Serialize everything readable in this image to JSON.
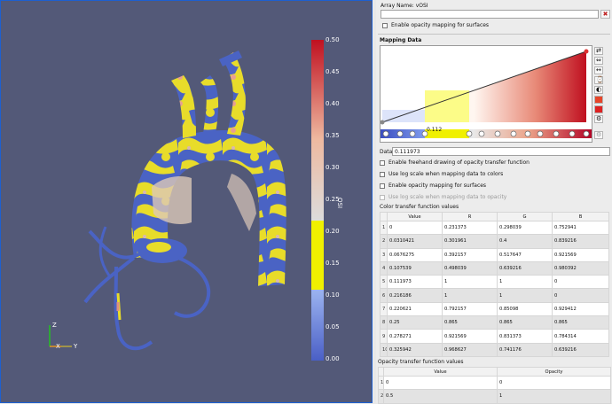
{
  "viewport": {
    "axes": {
      "z": "Z",
      "x": "X",
      "y": "Y"
    },
    "scalar_bar": {
      "title": "OSI",
      "labels": [
        "0.50",
        "0.45",
        "0.40",
        "0.35",
        "0.30",
        "0.25",
        "0.20",
        "0.15",
        "0.10",
        "0.05",
        "0.00"
      ]
    }
  },
  "panel": {
    "array_name": "Array Name: vOSI",
    "enable_opacity_surfaces": "Enable opacity mapping for surfaces",
    "mapping_data_title": "Mapping Data",
    "highlight_value": "0.112",
    "data_label": "Data:",
    "data_value": "0.111973",
    "options": [
      {
        "label": "Enable freehand drawing of opacity transfer function",
        "disabled": false
      },
      {
        "label": "Use log scale when mapping data to colors",
        "disabled": false
      },
      {
        "label": "Enable opacity mapping for surfaces",
        "disabled": false
      },
      {
        "label": "Use log scale when mapping data to opacity",
        "disabled": true
      }
    ],
    "color_table_title": "Color transfer function values",
    "color_table_headers": [
      "Value",
      "R",
      "G",
      "B"
    ],
    "color_table_rows": [
      [
        "1",
        "0",
        "0.231373",
        "0.298039",
        "0.752941"
      ],
      [
        "2",
        "0.0310421",
        "0.301961",
        "0.4",
        "0.839216"
      ],
      [
        "3",
        "0.0676275",
        "0.392157",
        "0.517647",
        "0.921569"
      ],
      [
        "4",
        "0.107539",
        "0.498039",
        "0.639216",
        "0.980392"
      ],
      [
        "5",
        "0.111973",
        "1",
        "1",
        "0"
      ],
      [
        "6",
        "0.216186",
        "1",
        "1",
        "0"
      ],
      [
        "7",
        "0.220621",
        "0.792157",
        "0.85098",
        "0.929412"
      ],
      [
        "8",
        "0.25",
        "0.865",
        "0.865",
        "0.865"
      ],
      [
        "9",
        "0.278271",
        "0.921569",
        "0.831373",
        "0.784314"
      ],
      [
        "10",
        "0.325942",
        "0.968627",
        "0.741176",
        "0.639216"
      ]
    ],
    "opacity_table_title": "Opacity transfer function values",
    "opacity_table_headers": [
      "Value",
      "Opacity"
    ],
    "opacity_table_rows": [
      [
        "1",
        "0",
        "0"
      ],
      [
        "2",
        "0.5",
        "1"
      ]
    ]
  }
}
